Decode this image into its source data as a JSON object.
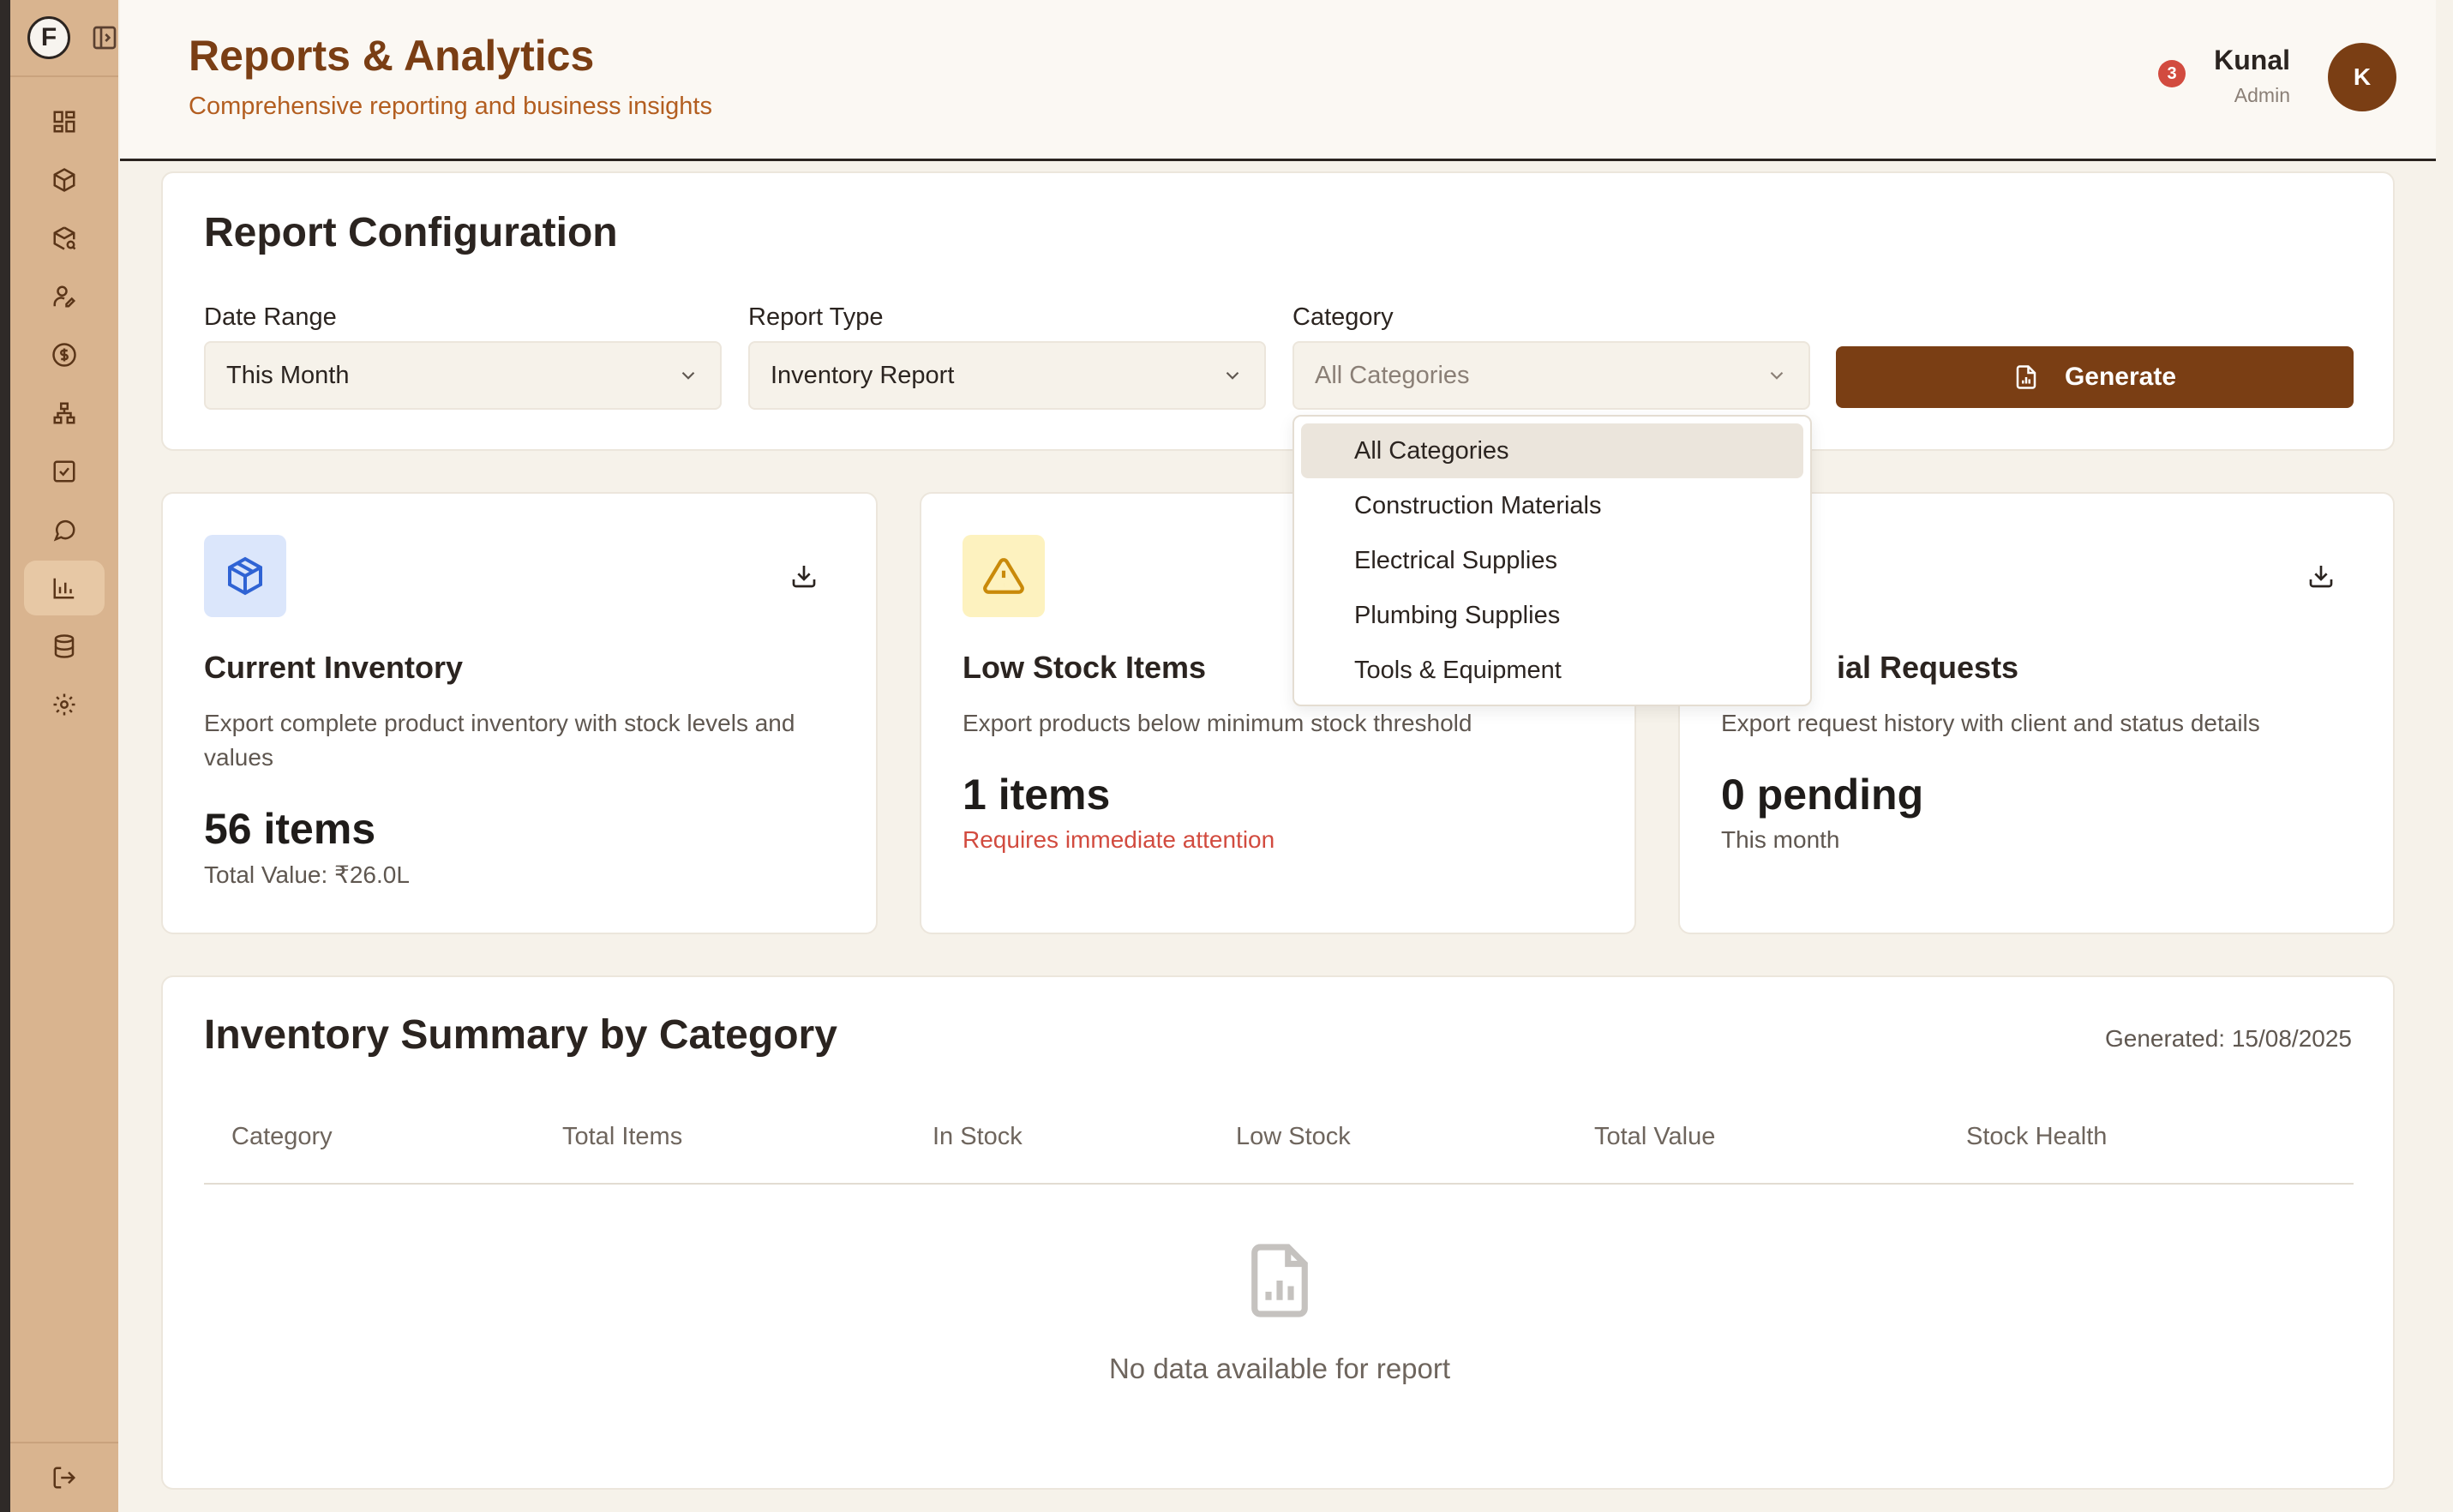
{
  "header": {
    "title": "Reports & Analytics",
    "subtitle": "Comprehensive reporting and business insights",
    "notifications_count": "3",
    "user_name": "Kunal",
    "user_role": "Admin",
    "avatar_initial": "K"
  },
  "sidebar": {
    "logo_letter": "F",
    "items": [
      "dashboard-icon",
      "package-icon",
      "package-search-icon",
      "user-edit-icon",
      "dollar-icon",
      "network-icon",
      "checkbox-icon",
      "chat-icon",
      "bar-chart-icon",
      "database-icon",
      "settings-icon"
    ],
    "active_index": 8
  },
  "config": {
    "title": "Report Configuration",
    "date_range_label": "Date Range",
    "date_range_value": "This Month",
    "report_type_label": "Report Type",
    "report_type_value": "Inventory Report",
    "category_label": "Category",
    "category_value": "All Categories",
    "generate_label": "Generate"
  },
  "category_options": [
    "All Categories",
    "Construction Materials",
    "Electrical Supplies",
    "Plumbing Supplies",
    "Tools & Equipment"
  ],
  "cards": [
    {
      "title": "Current Inventory",
      "description": "Export complete product inventory with stock levels and values",
      "value": "56 items",
      "sub": "Total Value: ₹26.0L"
    },
    {
      "title": "Low Stock Items",
      "description": "Export products below minimum stock threshold",
      "value": "1 items",
      "sub": "Requires immediate attention"
    },
    {
      "title": "ial Requests",
      "description": "Export request history with client and status details",
      "value": "0 pending",
      "sub": "This month"
    }
  ],
  "summary": {
    "title": "Inventory Summary by Category",
    "generated": "Generated: 15/08/2025",
    "columns": [
      "Category",
      "Total Items",
      "In Stock",
      "Low Stock",
      "Total Value",
      "Stock Health"
    ],
    "empty_text": "No data available for report"
  },
  "colors": {
    "brand": "#7a3e14",
    "sidebar": "#d9b48f",
    "background": "#f6f2ea",
    "alert": "#d24b3f"
  }
}
